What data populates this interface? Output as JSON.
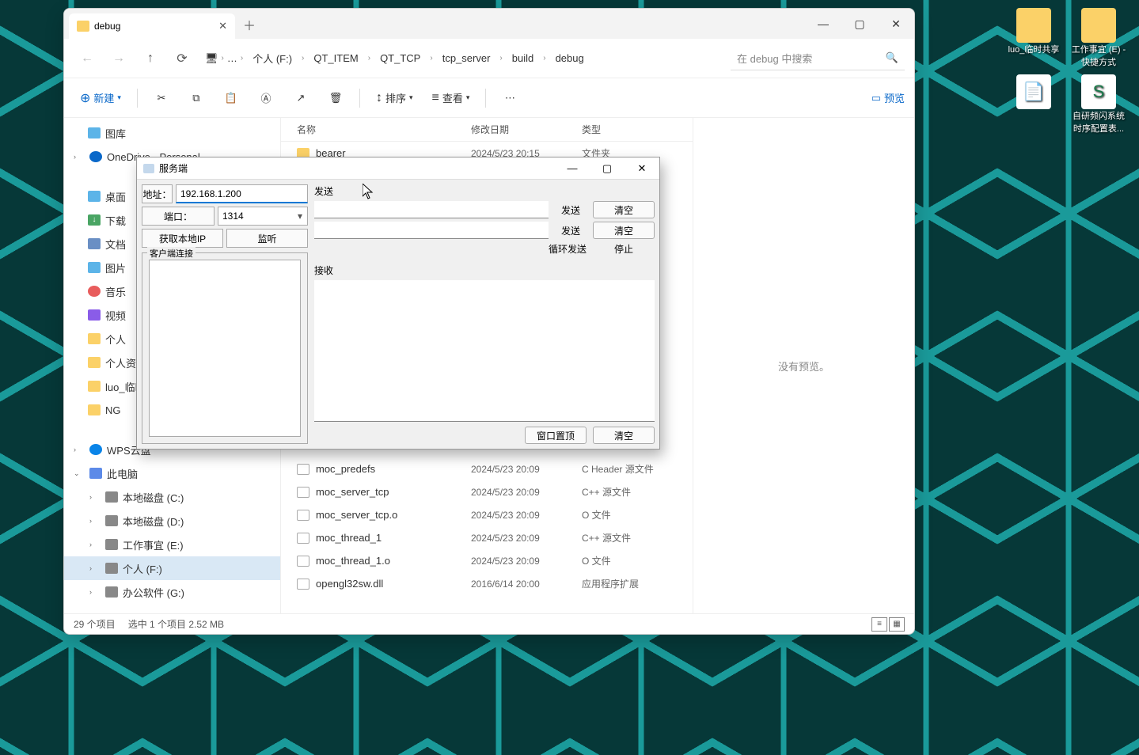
{
  "desktop_icons": [
    {
      "label": "luo_临时共享",
      "cls": "folder"
    },
    {
      "label": "工作事宜 (E) - 快捷方式",
      "cls": "folder"
    },
    {
      "label": "",
      "cls": "txt"
    },
    {
      "label": "自研频闪系统时序配置表...",
      "cls": "xls"
    }
  ],
  "explorer": {
    "tab_title": "debug",
    "breadcrumbs": [
      "个人 (F:)",
      "QT_ITEM",
      "QT_TCP",
      "tcp_server",
      "build",
      "debug"
    ],
    "search_placeholder": "在 debug 中搜索",
    "toolbar": {
      "new": "新建",
      "sort": "排序",
      "view": "查看",
      "preview": "预览"
    },
    "columns": {
      "name": "名称",
      "date": "修改日期",
      "type": "类型"
    },
    "preview_empty": "没有预览。",
    "sidebar": {
      "gallery": "图库",
      "onedrive": "OneDrive - Personal",
      "quick": [
        "桌面",
        "下载",
        "文档",
        "图片",
        "音乐",
        "视频",
        "个人",
        "个人资料",
        "luo_临时",
        "NG"
      ],
      "wps": "WPS云盘",
      "thispc": "此电脑",
      "drives": [
        "本地磁盘 (C:)",
        "本地磁盘 (D:)",
        "工作事宜 (E:)",
        "个人 (F:)",
        "办公软件 (G:)"
      ]
    },
    "files": [
      {
        "name": "bearer",
        "date": "2024/5/23 20:15",
        "type": "文件夹",
        "icon": "fi-folder"
      },
      {
        "name": "moc_predefs",
        "date": "2024/5/23 20:09",
        "type": "C Header 源文件",
        "icon": "fi-c"
      },
      {
        "name": "moc_server_tcp",
        "date": "2024/5/23 20:09",
        "type": "C++ 源文件",
        "icon": "fi-c"
      },
      {
        "name": "moc_server_tcp.o",
        "date": "2024/5/23 20:09",
        "type": "O 文件",
        "icon": "fi-o"
      },
      {
        "name": "moc_thread_1",
        "date": "2024/5/23 20:09",
        "type": "C++ 源文件",
        "icon": "fi-c"
      },
      {
        "name": "moc_thread_1.o",
        "date": "2024/5/23 20:09",
        "type": "O 文件",
        "icon": "fi-o"
      },
      {
        "name": "opengl32sw.dll",
        "date": "2016/6/14 20:00",
        "type": "应用程序扩展",
        "icon": "fi-dll"
      }
    ],
    "status": {
      "count": "29 个项目",
      "selected": "选中 1 个项目  2.52 MB"
    }
  },
  "dialog": {
    "title": "服务端",
    "addr_label": "地址：",
    "addr_value": "192.168.1.200",
    "port_label": "端口：",
    "port_value": "1314",
    "get_local_ip": "获取本地IP",
    "listen": "监听",
    "client_conn": "客户端连接",
    "send_title": "发送",
    "send": "发送",
    "clear": "清空",
    "loop_send": "循环发送",
    "stop": "停止",
    "recv_title": "接收",
    "pin_window": "窗口置顶"
  }
}
